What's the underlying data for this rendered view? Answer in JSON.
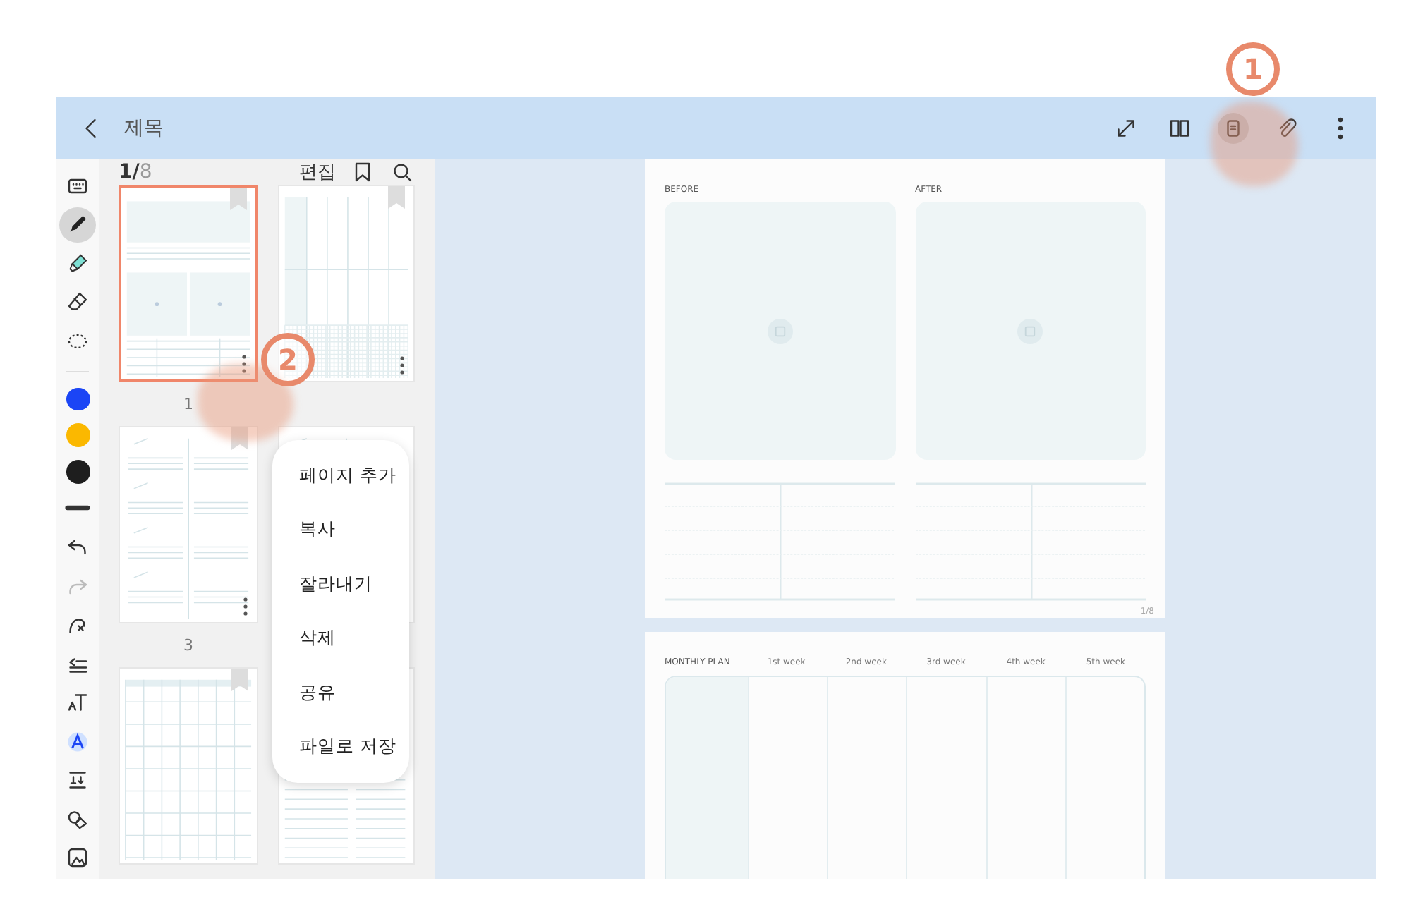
{
  "app_bar": {
    "title": "제목",
    "actions": [
      {
        "kind": "expand",
        "selected": false
      },
      {
        "kind": "book",
        "selected": false
      },
      {
        "kind": "page-list",
        "selected": true
      },
      {
        "kind": "clip",
        "selected": false
      },
      {
        "kind": "more",
        "selected": false
      }
    ]
  },
  "annotations": [
    {
      "label": "1"
    },
    {
      "label": "2"
    }
  ],
  "tools": [
    {
      "kind": "keyboard",
      "selected": false,
      "disabled": false
    },
    {
      "kind": "pen",
      "selected": true,
      "disabled": false
    },
    {
      "kind": "highlighter",
      "selected": false,
      "disabled": false
    },
    {
      "kind": "eraser",
      "selected": false,
      "disabled": false
    },
    {
      "kind": "lasso",
      "selected": false,
      "disabled": false
    },
    {
      "kind": "color",
      "selected": false,
      "disabled": false,
      "color": "#1b45f5"
    },
    {
      "kind": "color",
      "selected": false,
      "disabled": false,
      "color": "#fbb800"
    },
    {
      "kind": "color",
      "selected": false,
      "disabled": false,
      "color": "#1e1e1e"
    },
    {
      "kind": "thickness",
      "selected": false,
      "disabled": false
    },
    {
      "kind": "undo",
      "selected": false,
      "disabled": false
    },
    {
      "kind": "redo",
      "selected": false,
      "disabled": true
    },
    {
      "kind": "shape-pen",
      "selected": false,
      "disabled": false
    },
    {
      "kind": "align",
      "selected": false,
      "disabled": false
    },
    {
      "kind": "text",
      "selected": false,
      "disabled": false
    },
    {
      "kind": "font",
      "selected": false,
      "disabled": false
    },
    {
      "kind": "ruled-text",
      "selected": false,
      "disabled": false
    },
    {
      "kind": "shapes",
      "selected": false,
      "disabled": false
    },
    {
      "kind": "image",
      "selected": false,
      "disabled": false
    }
  ],
  "thumbnail_panel": {
    "page_current": "1/",
    "page_total": "8",
    "edit": "편집",
    "thumbnails": [
      {
        "kind": "before-after",
        "selected": true,
        "label": "1"
      },
      {
        "kind": "weekly",
        "selected": false
      },
      {
        "kind": "checklist",
        "selected": false,
        "label": "3"
      },
      {
        "kind": "checklist",
        "selected": false
      },
      {
        "kind": "calendar",
        "selected": false
      },
      {
        "kind": "grid-notes",
        "selected": false
      }
    ]
  },
  "context_menu": {
    "items": [
      "페이지 추가",
      "복사",
      "잘라내기",
      "삭제",
      "공유",
      "파일로 저장"
    ]
  },
  "pages": [
    {
      "kind": "before-after",
      "labels": [
        "BEFORE",
        "AFTER"
      ],
      "page_number": "1/8"
    },
    {
      "kind": "monthly",
      "title": "MONTHLY PLAN",
      "columns": [
        "1st week",
        "2nd week",
        "3rd week",
        "4th week",
        "5th week"
      ]
    }
  ]
}
